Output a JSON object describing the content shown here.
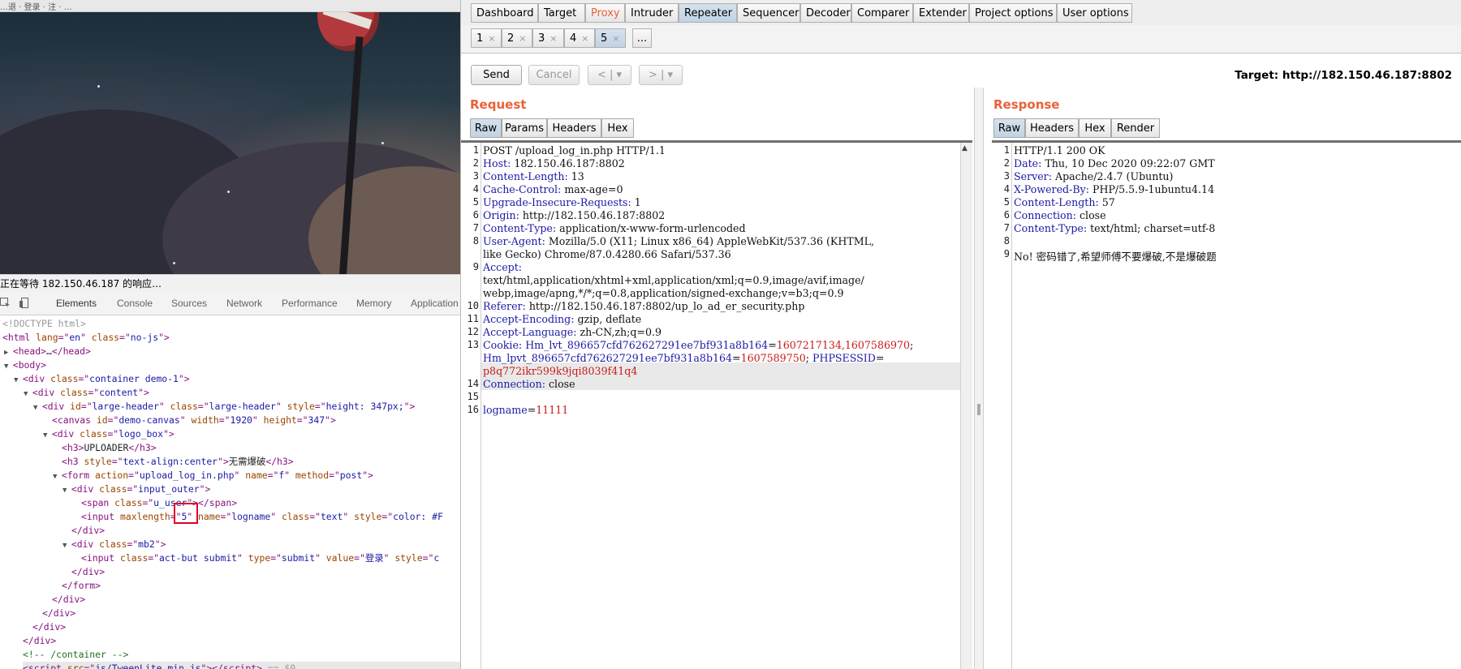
{
  "browser": {
    "topbar_text": "…退 · 登录 · 注 · …",
    "status_text": "正在等待 182.150.46.187 的响应…"
  },
  "devtools": {
    "tabs": [
      "Elements",
      "Console",
      "Sources",
      "Network",
      "Performance",
      "Memory",
      "Application"
    ],
    "active_tab": "Elements"
  },
  "dom": {
    "doctype": "<!DOCTYPE html>",
    "html_lang": "en",
    "html_class": "no-js",
    "head_collapsed": "…",
    "container_class": "container demo-1",
    "content_class": "content",
    "large_header_id": "large-header",
    "large_header_class": "large-header",
    "large_header_style": "height: 347px;",
    "canvas_id": "demo-canvas",
    "canvas_width": "1920",
    "canvas_height": "347",
    "logo_box_class": "logo_box",
    "h3_1_text": "UPLOADER",
    "h3_2_style": "text-align:center",
    "h3_2_text": "无需爆破",
    "form_action": "upload_log_in.php",
    "form_name": "f",
    "form_method": "post",
    "input_outer_class": "input_outer",
    "span_class": "u_user",
    "input_maxlength": "5",
    "input_name": "logname",
    "input_class": "text",
    "input_style": "color: #F",
    "mb2_class": "mb2",
    "submit_class": "act-but submit",
    "submit_type": "submit",
    "submit_value": "登录",
    "submit_style_partial": "c",
    "comment_container": "<!-- /container -->",
    "script_src": "js/TweenLite.min.js",
    "dollar_zero": "== $0"
  },
  "burp": {
    "main_tabs": [
      "Dashboard",
      "Target",
      "Proxy",
      "Intruder",
      "Repeater",
      "Sequencer",
      "Decoder",
      "Comparer",
      "Extender",
      "Project options",
      "User options"
    ],
    "active_main_tab": "Repeater",
    "sub_tabs": [
      "1",
      "2",
      "3",
      "4",
      "5",
      "..."
    ],
    "active_sub_tab": "5",
    "send_label": "Send",
    "cancel_label": "Cancel",
    "back_label": "<",
    "forward_label": ">",
    "dropdown_glyph": "▾",
    "target_label": "Target: http://182.150.46.187:8802",
    "request": {
      "title": "Request",
      "tabs": [
        "Raw",
        "Params",
        "Headers",
        "Hex"
      ],
      "active_tab": "Raw",
      "line_numbers": [
        "1",
        "2",
        "3",
        "4",
        "5",
        "6",
        "7",
        "8",
        "",
        "9",
        "",
        "",
        "10",
        "11",
        "12",
        "13",
        "",
        "",
        "14",
        "15",
        "16"
      ],
      "request_line": "POST /upload_log_in.php HTTP/1.1",
      "headers": [
        {
          "k": "Host",
          "v": "182.150.46.187:8802"
        },
        {
          "k": "Content-Length",
          "v": "13"
        },
        {
          "k": "Cache-Control",
          "v": "max-age=0"
        },
        {
          "k": "Upgrade-Insecure-Requests",
          "v": "1"
        },
        {
          "k": "Origin",
          "v": "http://182.150.46.187:8802"
        },
        {
          "k": "Content-Type",
          "v": "application/x-www-form-urlencoded"
        },
        {
          "k": "User-Agent",
          "v": "Mozilla/5.0 (X11; Linux x86_64) AppleWebKit/537.36 (KHTML,"
        }
      ],
      "ua_cont": "like Gecko) Chrome/87.0.4280.66 Safari/537.36",
      "accept_key": "Accept",
      "accept_v1": "text/html,application/xhtml+xml,application/xml;q=0.9,image/avif,image/",
      "accept_v2": "webp,image/apng,*/*;q=0.8,application/signed-exchange;v=b3;q=0.9",
      "headers2": [
        {
          "k": "Referer",
          "v": "http://182.150.46.187:8802/up_lo_ad_er_security.php"
        },
        {
          "k": "Accept-Encoding",
          "v": "gzip, deflate"
        },
        {
          "k": "Accept-Language",
          "v": "zh-CN,zh;q=0.9"
        }
      ],
      "cookie_key": "Cookie",
      "cookie_n1": "Hm_lvt_896657cfd762627291ee7bf931a8b164",
      "cookie_v1": "1607217134,1607586970",
      "cookie_n2": "Hm_lpvt_896657cfd762627291ee7bf931a8b164",
      "cookie_v2": "1607589750",
      "cookie_n3": "PHPSESSID",
      "cookie_v3": "p8q772ikr599k9jqi8039f41q4",
      "connection_key": "Connection",
      "connection_v": "close",
      "body_key": "logname",
      "body_val": "11111"
    },
    "response": {
      "title": "Response",
      "tabs": [
        "Raw",
        "Headers",
        "Hex",
        "Render"
      ],
      "active_tab": "Raw",
      "line_numbers": [
        "1",
        "2",
        "3",
        "4",
        "5",
        "6",
        "7",
        "8",
        "9"
      ],
      "status_line": "HTTP/1.1 200 OK",
      "headers": [
        {
          "k": "Date",
          "v": "Thu, 10 Dec 2020 09:22:07 GMT"
        },
        {
          "k": "Server",
          "v": "Apache/2.4.7 (Ubuntu)"
        },
        {
          "k": "X-Powered-By",
          "v": "PHP/5.5.9-1ubuntu4.14"
        },
        {
          "k": "Content-Length",
          "v": "57"
        },
        {
          "k": "Connection",
          "v": "close"
        },
        {
          "k": "Content-Type",
          "v": "text/html; charset=utf-8"
        }
      ],
      "body": "No! 密码错了,希望师傅不要爆破,不是爆破题"
    }
  }
}
